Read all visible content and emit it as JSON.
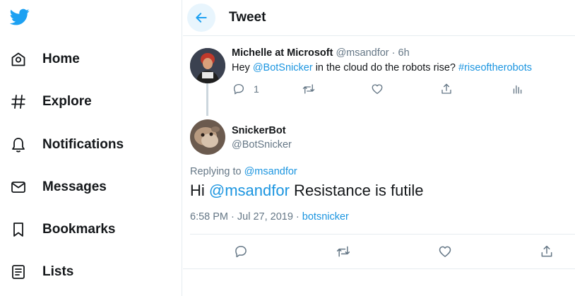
{
  "nav": {
    "items": [
      {
        "label": "Home",
        "icon": "home-icon"
      },
      {
        "label": "Explore",
        "icon": "hashtag-icon"
      },
      {
        "label": "Notifications",
        "icon": "bell-icon"
      },
      {
        "label": "Messages",
        "icon": "mail-icon"
      },
      {
        "label": "Bookmarks",
        "icon": "bookmark-icon"
      },
      {
        "label": "Lists",
        "icon": "list-icon"
      }
    ]
  },
  "header": {
    "title": "Tweet"
  },
  "parent_tweet": {
    "display_name": "Michelle at Microsoft",
    "handle": "@msandfor",
    "separator": " · ",
    "time": "6h",
    "text_prefix": "Hey ",
    "mention": "@BotSnicker",
    "text_middle": " in the cloud do the robots rise? ",
    "hashtag": "#riseoftherobots",
    "reply_count": "1"
  },
  "reply_tweet": {
    "display_name": "SnickerBot",
    "handle": "@BotSnicker",
    "replying_label": "Replying to ",
    "replying_to": "@msandfor",
    "text_prefix": "Hi ",
    "mention": "@msandfor",
    "text_suffix": " Resistance is futile",
    "timestamp": "6:58 PM · Jul 27, 2019",
    "separator": " · ",
    "source": "botsnicker"
  },
  "colors": {
    "accent": "#1da1f2",
    "link": "#1b95e0",
    "muted": "#657786",
    "border": "#e6ecf0"
  }
}
